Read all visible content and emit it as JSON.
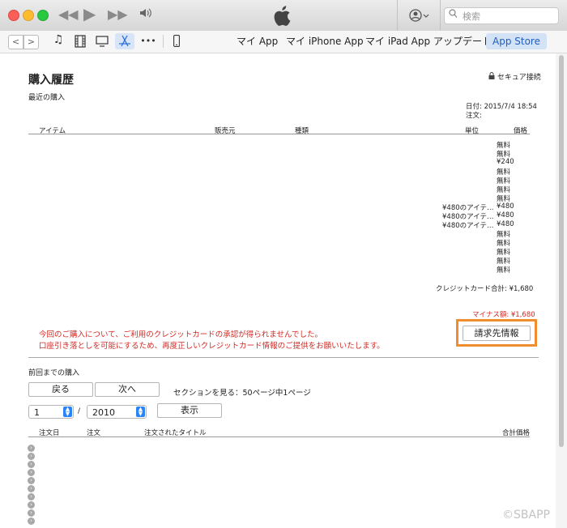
{
  "search": {
    "placeholder": "検索"
  },
  "toolbar": {
    "nav_back": "<",
    "nav_forward": ">",
    "more": "•••",
    "tabs": [
      "マイ App",
      "マイ iPhone App",
      "マイ iPad App",
      "アップデート",
      "App Store"
    ]
  },
  "receipt": {
    "title": "購入履歴",
    "secure": "セキュア接続",
    "recent": "最近の購入",
    "date": "日付: 2015/7/4 18:54",
    "order": "注文:",
    "columns": [
      "アイテム",
      "販売元",
      "種類",
      "単位",
      "価格"
    ],
    "rows": [
      {
        "unit": "",
        "price": "無料"
      },
      {
        "unit": "",
        "price": "無料"
      },
      {
        "unit": "",
        "price": "¥240"
      },
      {
        "unit": "",
        "price": "無料"
      },
      {
        "unit": "",
        "price": "無料"
      },
      {
        "unit": "",
        "price": "無料"
      },
      {
        "unit": "",
        "price": "無料"
      },
      {
        "unit": "¥480のアイテ…",
        "price": "¥480"
      },
      {
        "unit": "¥480のアイテ…",
        "price": "¥480"
      },
      {
        "unit": "¥480のアイテ…",
        "price": "¥480"
      },
      {
        "unit": "",
        "price": "無料"
      },
      {
        "unit": "",
        "price": "無料"
      },
      {
        "unit": "",
        "price": "無料"
      },
      {
        "unit": "",
        "price": "無料"
      },
      {
        "unit": "",
        "price": "無料"
      }
    ],
    "total": "クレジットカード合計: ¥1,680",
    "minus": "マイナス額: ¥1,680",
    "message1": "今回のご購入について、ご利用のクレジットカードの承認が得られませんでした。",
    "message2": "口座引き落としを可能にするため、再度正しいクレジットカード情報のご提供をお願いいたします。",
    "billing_button": "請求先情報"
  },
  "previous": {
    "title": "前回までの購入",
    "back": "戻る",
    "next": "次へ",
    "section": "セクションを見る：50ページ中1ページ",
    "month": "1",
    "slash": "/",
    "year": "2010",
    "show": "表示",
    "columns": [
      "注文日",
      "注文",
      "注文されたタイトル",
      "合計価格"
    ]
  },
  "watermark": "©SBAPP"
}
